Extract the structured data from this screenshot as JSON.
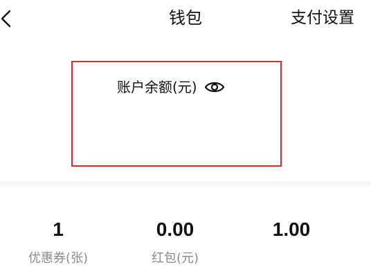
{
  "header": {
    "title": "钱包",
    "pay_settings_label": "支付设置",
    "back_icon": "chevron-left-icon"
  },
  "balance": {
    "label": "账户余额(元)",
    "visibility_icon": "eye-icon",
    "highlight_color": "#d32f2f"
  },
  "stats": [
    {
      "value": "1",
      "label": "优惠券(张)"
    },
    {
      "value": "0.00",
      "label": "红包(元)"
    },
    {
      "value": "1.00",
      "label": ""
    }
  ]
}
